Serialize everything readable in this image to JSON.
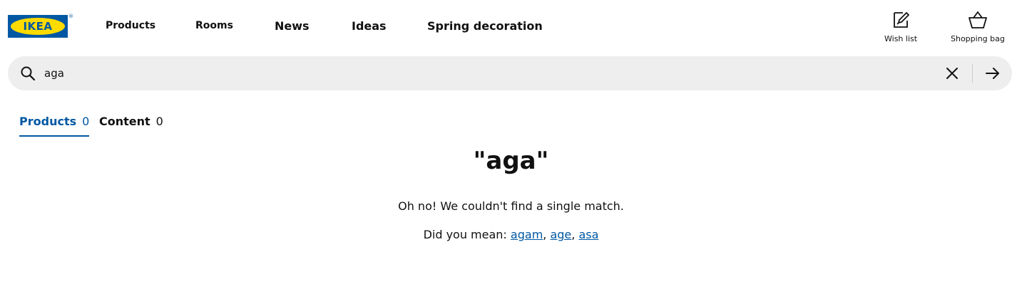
{
  "brand": {
    "logo_text": "IKEA",
    "registered_mark": "®",
    "colors": {
      "blue": "#0058a3",
      "yellow": "#ffdb00"
    }
  },
  "nav": {
    "products": "Products",
    "rooms": "Rooms",
    "news": "News",
    "ideas": "Ideas",
    "spring": "Spring decoration"
  },
  "header_actions": {
    "wishlist_label": "Wish list",
    "wishlist_icon": "pencil-on-paper-icon",
    "bag_label": "Shopping bag",
    "bag_icon": "basket-icon"
  },
  "search": {
    "value": "aga",
    "icons": [
      "search-icon",
      "clear-icon",
      "arrow-right-icon"
    ]
  },
  "tabs": [
    {
      "label": "Products",
      "count": "0",
      "active": true
    },
    {
      "label": "Content",
      "count": "0",
      "active": false
    }
  ],
  "results": {
    "query_display": "\"aga\"",
    "no_match_text": "Oh no! We couldn't find a single match.",
    "did_you_mean_label": "Did you mean:",
    "suggestions": [
      "agam",
      "age",
      "asa"
    ],
    "separator": ","
  },
  "colors": {
    "text": "#111111",
    "link": "#0058a3",
    "search_bg": "#eeeeee"
  }
}
